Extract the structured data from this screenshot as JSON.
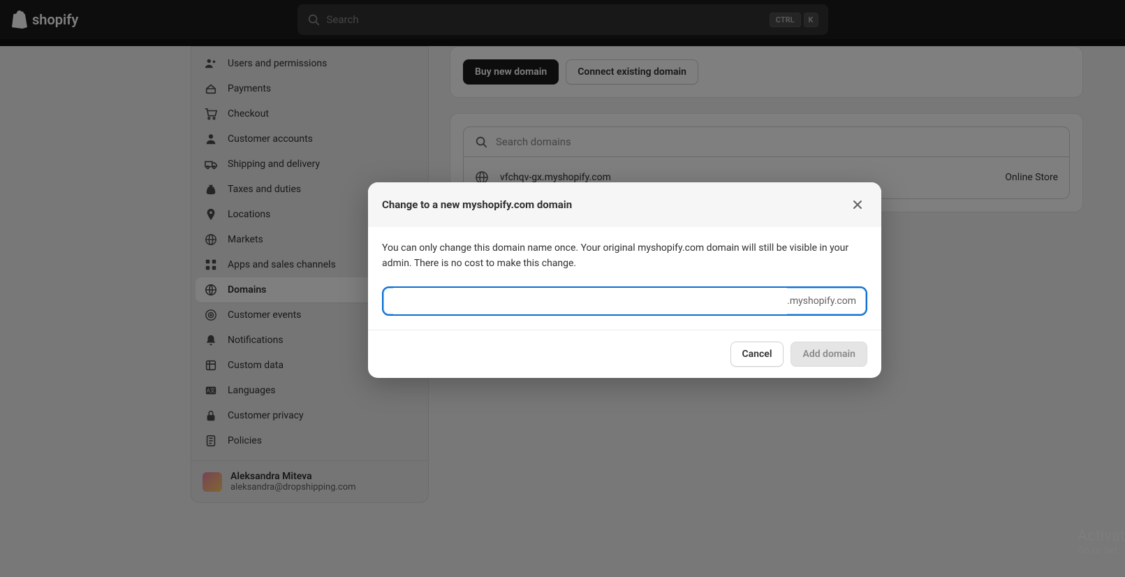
{
  "brand": {
    "name": "shopify"
  },
  "search": {
    "placeholder": "Search",
    "kbd1": "CTRL",
    "kbd2": "K"
  },
  "main": {
    "buy_label": "Buy new domain",
    "connect_label": "Connect existing domain",
    "search_placeholder": "Search domains",
    "domain_row": {
      "name": "vfchqv-gx.myshopify.com",
      "target": "Online Store"
    }
  },
  "sidebar": {
    "items": [
      {
        "label": "Users and permissions",
        "icon": "users-icon"
      },
      {
        "label": "Payments",
        "icon": "card-icon"
      },
      {
        "label": "Checkout",
        "icon": "cart-icon"
      },
      {
        "label": "Customer accounts",
        "icon": "person-icon"
      },
      {
        "label": "Shipping and delivery",
        "icon": "truck-icon"
      },
      {
        "label": "Taxes and duties",
        "icon": "money-bag-icon"
      },
      {
        "label": "Locations",
        "icon": "pin-icon"
      },
      {
        "label": "Markets",
        "icon": "globe-icon"
      },
      {
        "label": "Apps and sales channels",
        "icon": "apps-icon"
      },
      {
        "label": "Domains",
        "icon": "domain-icon"
      },
      {
        "label": "Customer events",
        "icon": "target-icon"
      },
      {
        "label": "Notifications",
        "icon": "bell-icon"
      },
      {
        "label": "Custom data",
        "icon": "data-icon"
      },
      {
        "label": "Languages",
        "icon": "language-icon"
      },
      {
        "label": "Customer privacy",
        "icon": "lock-icon"
      },
      {
        "label": "Policies",
        "icon": "policy-icon"
      }
    ]
  },
  "user": {
    "name": "Aleksandra Miteva",
    "email": "aleksandra@dropshipping.com"
  },
  "modal": {
    "title": "Change to a new myshopify.com domain",
    "desc": "You can only change this domain name once. Your original myshopify.com domain will still be visible in your admin. There is no cost to make this change.",
    "suffix": ".myshopify.com",
    "cancel_label": "Cancel",
    "add_label": "Add domain"
  },
  "watermark": {
    "line1": "Activat",
    "line2": "Go to Set"
  }
}
